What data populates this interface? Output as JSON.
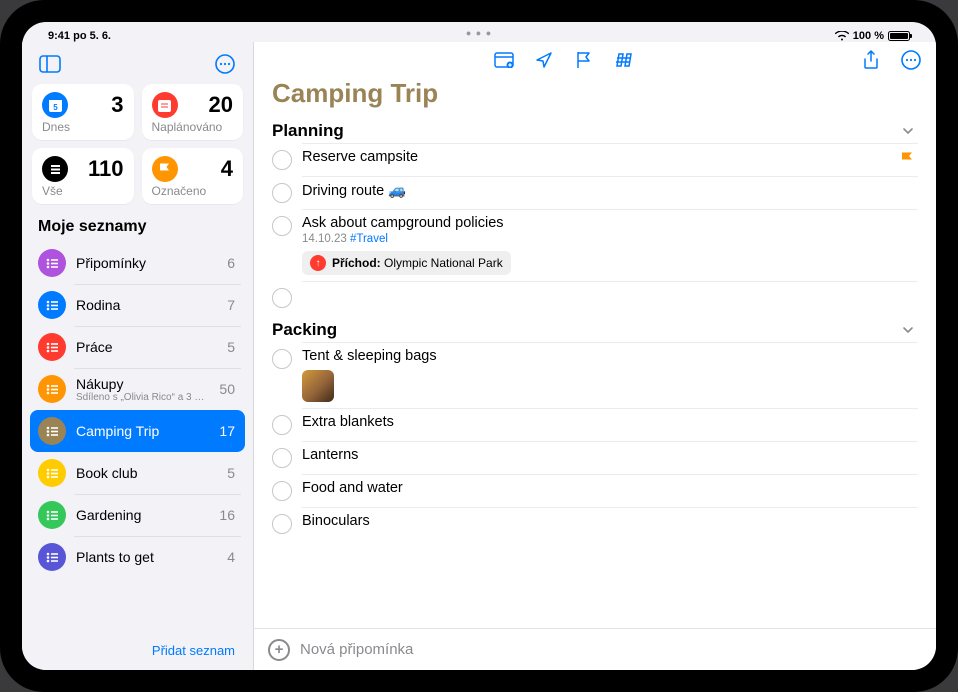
{
  "status": {
    "time": "9:41",
    "date": "po 5. 6.",
    "battery_text": "100 %"
  },
  "sidebar": {
    "smart": [
      {
        "label": "Dnes",
        "count": "3",
        "color": "#007aff"
      },
      {
        "label": "Naplánováno",
        "count": "20",
        "color": "#ff3b30"
      },
      {
        "label": "Vše",
        "count": "110",
        "color": "#000000"
      },
      {
        "label": "Označeno",
        "count": "4",
        "color": "#ff9500"
      }
    ],
    "heading": "Moje seznamy",
    "lists": [
      {
        "name": "Připomínky",
        "count": "6",
        "color": "#af52de",
        "sub": ""
      },
      {
        "name": "Rodina",
        "count": "7",
        "color": "#007aff",
        "sub": ""
      },
      {
        "name": "Práce",
        "count": "5",
        "color": "#ff3b30",
        "sub": ""
      },
      {
        "name": "Nákupy",
        "count": "50",
        "color": "#ff9500",
        "sub": "Sdíleno s „Olivia Rico“ a 3 dal…"
      },
      {
        "name": "Camping Trip",
        "count": "17",
        "color": "#9a8456",
        "sub": "",
        "active": true
      },
      {
        "name": "Book club",
        "count": "5",
        "color": "#ffcc00",
        "sub": ""
      },
      {
        "name": "Gardening",
        "count": "16",
        "color": "#34c759",
        "sub": ""
      },
      {
        "name": "Plants to get",
        "count": "4",
        "color": "#5856d6",
        "sub": ""
      }
    ],
    "footer": "Přidat seznam"
  },
  "main": {
    "title": "Camping Trip",
    "sections": [
      {
        "title": "Planning",
        "items": [
          {
            "title": "Reserve campsite",
            "flagged": true
          },
          {
            "title": "Driving route 🚙"
          },
          {
            "title": "Ask about campground policies",
            "sub_date": "14.10.23",
            "sub_tag": "#Travel",
            "pill_label": "Příchod:",
            "pill_value": "Olympic National Park"
          },
          {
            "title": ""
          }
        ]
      },
      {
        "title": "Packing",
        "items": [
          {
            "title": "Tent & sleeping bags",
            "thumb": true
          },
          {
            "title": "Extra blankets"
          },
          {
            "title": "Lanterns"
          },
          {
            "title": "Food and water"
          },
          {
            "title": "Binoculars"
          }
        ]
      }
    ],
    "new_reminder": "Nová připomínka"
  }
}
